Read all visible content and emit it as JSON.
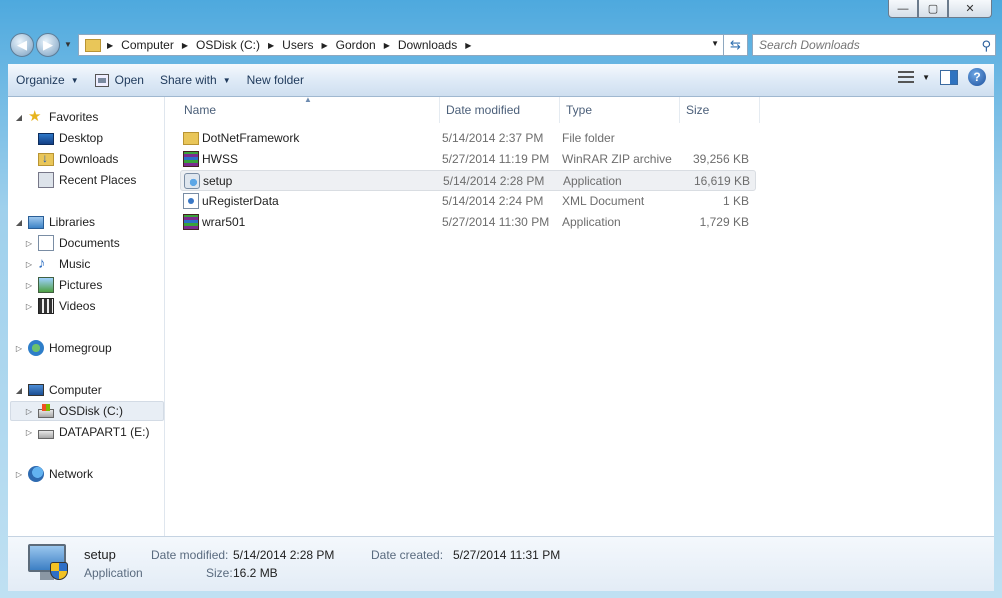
{
  "window": {
    "minimize": "—",
    "maximize": "▢",
    "close": "✕"
  },
  "address": {
    "crumbs": [
      "Computer",
      "OSDisk (C:)",
      "Users",
      "Gordon",
      "Downloads"
    ]
  },
  "search": {
    "placeholder": "Search Downloads"
  },
  "toolbar": {
    "organize": "Organize",
    "open": "Open",
    "share_with": "Share with",
    "new_folder": "New folder"
  },
  "nav": {
    "favorites": "Favorites",
    "desktop": "Desktop",
    "downloads": "Downloads",
    "recent_places": "Recent Places",
    "libraries": "Libraries",
    "documents": "Documents",
    "music": "Music",
    "pictures": "Pictures",
    "videos": "Videos",
    "homegroup": "Homegroup",
    "computer": "Computer",
    "osdisk": "OSDisk (C:)",
    "datapart": "DATAPART1 (E:)",
    "network": "Network"
  },
  "columns": {
    "name": "Name",
    "date": "Date modified",
    "type": "Type",
    "size": "Size"
  },
  "files": [
    {
      "name": "DotNetFramework",
      "date": "5/14/2014 2:37 PM",
      "type": "File folder",
      "size": "",
      "icon": "folder-icon"
    },
    {
      "name": "HWSS",
      "date": "5/27/2014 11:19 PM",
      "type": "WinRAR ZIP archive",
      "size": "39,256 KB",
      "icon": "winrar-archive-icon"
    },
    {
      "name": "setup",
      "date": "5/14/2014 2:28 PM",
      "type": "Application",
      "size": "16,619 KB",
      "icon": "setup-application-icon"
    },
    {
      "name": "uRegisterData",
      "date": "5/14/2014 2:24 PM",
      "type": "XML Document",
      "size": "1 KB",
      "icon": "xml-document-icon"
    },
    {
      "name": "wrar501",
      "date": "5/27/2014 11:30 PM",
      "type": "Application",
      "size": "1,729 KB",
      "icon": "winrar-installer-icon"
    }
  ],
  "details": {
    "name": "setup",
    "kind": "Application",
    "date_modified_label": "Date modified:",
    "date_modified": "5/14/2014 2:28 PM",
    "date_created_label": "Date created:",
    "date_created": "5/27/2014 11:31 PM",
    "size_label": "Size:",
    "size": "16.2 MB"
  }
}
